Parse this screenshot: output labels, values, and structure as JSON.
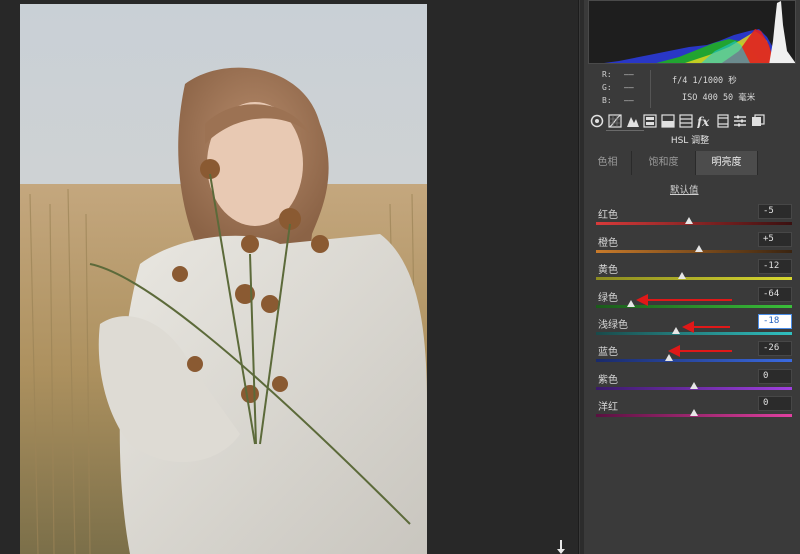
{
  "readout": {
    "r_label": "R:",
    "g_label": "G:",
    "b_label": "B:",
    "r_value": "——",
    "g_value": "——",
    "b_value": "——",
    "exposure": "f/4  1/1000 秒",
    "iso_focal": "ISO 400  50 毫米"
  },
  "tools": [
    {
      "name": "basic-icon"
    },
    {
      "name": "tone-curve-icon"
    },
    {
      "name": "detail-icon"
    },
    {
      "name": "hsl-icon"
    },
    {
      "name": "split-toning-icon"
    },
    {
      "name": "lens-icon"
    },
    {
      "name": "fx-icon"
    },
    {
      "name": "camera-calibration-icon"
    },
    {
      "name": "presets-icon"
    },
    {
      "name": "snapshots-icon"
    }
  ],
  "panel": {
    "title": "HSL 调整",
    "tabs": [
      "色相",
      "饱和度",
      "明亮度"
    ],
    "active_tab": 2,
    "default_link": "默认值"
  },
  "sliders": [
    {
      "label": "红色",
      "value": "-5",
      "level": -5,
      "colors": [
        "#d93a3a",
        "#3a1010"
      ]
    },
    {
      "label": "橙色",
      "value": "+5",
      "level": 5,
      "colors": [
        "#c87a2a",
        "#3a2410"
      ]
    },
    {
      "label": "黄色",
      "value": "-12",
      "level": -12,
      "colors": [
        "#8a8a20",
        "#d8d830"
      ]
    },
    {
      "label": "绿色",
      "value": "-64",
      "level": -64,
      "colors": [
        "#1a5a1a",
        "#3ac03a"
      ]
    },
    {
      "label": "浅绿色",
      "value": "-18",
      "level": -18,
      "colors": [
        "#1a4a4a",
        "#30c0c0"
      ]
    },
    {
      "label": "蓝色",
      "value": "-26",
      "level": -26,
      "colors": [
        "#1a2a6a",
        "#3a6ae0"
      ]
    },
    {
      "label": "紫色",
      "value": "0",
      "level": 0,
      "colors": [
        "#3a1a6a",
        "#a040e0"
      ]
    },
    {
      "label": "洋红",
      "value": "0",
      "level": 0,
      "colors": [
        "#5a1040",
        "#e040a0"
      ]
    }
  ],
  "focused_slider": 4,
  "annotated_sliders": [
    3,
    4,
    5
  ],
  "colors": {
    "panel_bg": "#3a3a3a",
    "canvas_bg": "#282828",
    "arrow": "#e01818",
    "focus": "#4b8ee8"
  }
}
